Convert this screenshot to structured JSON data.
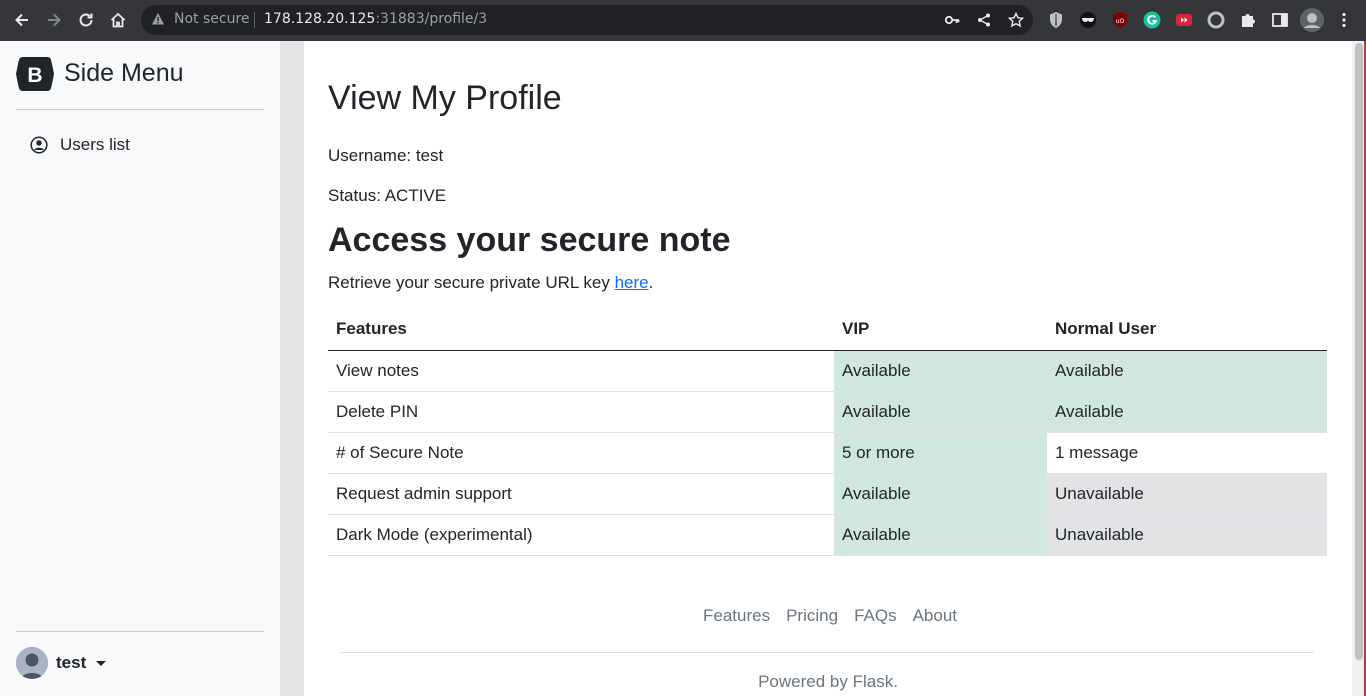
{
  "browser": {
    "security_label": "Not secure",
    "url_host": "178.128.20.125",
    "url_path": ":31883/profile/3"
  },
  "sidebar": {
    "brand_letter": "B",
    "title": "Side Menu",
    "items": [
      {
        "label": "Users list",
        "icon": "user-circle-icon"
      }
    ],
    "user": {
      "name": "test"
    }
  },
  "main": {
    "title": "View My Profile",
    "username_line": "Username: test",
    "status_line": "Status: ACTIVE",
    "note_title": "Access your secure note",
    "retrieve_prefix": "Retrieve your secure private URL key ",
    "retrieve_link": "here",
    "retrieve_suffix": "."
  },
  "table": {
    "headers": [
      "Features",
      "VIP",
      "Normal User"
    ],
    "rows": [
      [
        "View notes",
        "Available",
        "Available"
      ],
      [
        "Delete PIN",
        "Available",
        "Available"
      ],
      [
        "# of Secure Note",
        "5 or more",
        "1 message"
      ],
      [
        "Request admin support",
        "Available",
        "Unavailable"
      ],
      [
        "Dark Mode (experimental)",
        "Available",
        "Unavailable"
      ]
    ]
  },
  "footer": {
    "links": [
      "Features",
      "Pricing",
      "FAQs",
      "About"
    ],
    "text": "Powered by Flask."
  },
  "colors": {
    "available_bg": "#d1e7dd",
    "unavailable_bg": "#e2e3e5",
    "link": "#0d6efd"
  }
}
